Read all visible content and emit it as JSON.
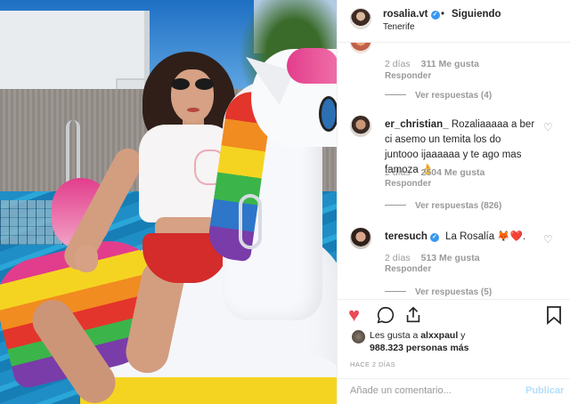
{
  "post": {
    "username": "rosalia.vt",
    "separator": "•",
    "follow_label": "Siguiendo",
    "location": "Tenerife"
  },
  "comments": [
    {
      "meta_time": "2 días",
      "meta_likes": "311 Me gusta",
      "reply_label": "Responder",
      "replies_label": "Ver respuestas (4)"
    },
    {
      "username": "er_christian_",
      "text": "Rozaliaaaaa a ber ci asemo un temita los do juntooo ijaaaaaa y te ago mas famoza 👌",
      "meta_time": "2 días",
      "meta_likes": "2504 Me gusta",
      "reply_label": "Responder",
      "replies_label": "Ver respuestas (826)"
    },
    {
      "username": "teresuch",
      "text": "La Rosalía 🦊❤️.",
      "meta_time": "2 días",
      "meta_likes": "513 Me gusta",
      "reply_label": "Responder",
      "replies_label": "Ver respuestas (5)"
    }
  ],
  "likes": {
    "prefix": "Les gusta a",
    "user": "alxxpaul",
    "conj": "y",
    "count": "988.323 personas más"
  },
  "timestamp": "HACE 2 DÍAS",
  "add_comment": {
    "placeholder": "Añade un comentario...",
    "publish_label": "Publicar"
  },
  "icons": {
    "like": "heart-icon",
    "comment": "comment-icon",
    "share": "share-icon",
    "save": "bookmark-icon",
    "verified": "verified-badge-icon",
    "comment_like": "small-heart-icon"
  },
  "colors": {
    "like_active": "#ed4956",
    "verified": "#3897f0",
    "publish_disabled": "#b2dffc",
    "muted_text": "#999999"
  }
}
